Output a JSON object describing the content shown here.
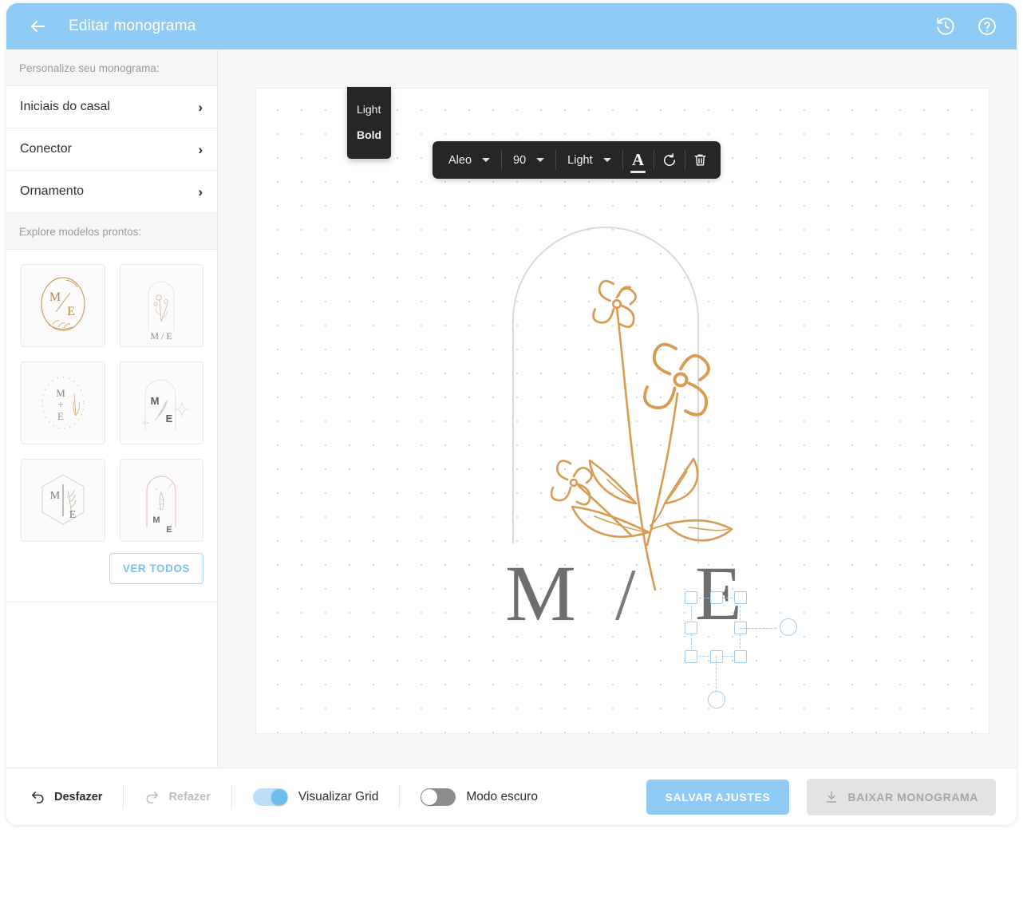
{
  "header": {
    "title": "Editar monograma",
    "back_icon": "arrow-left-icon",
    "history_icon": "history-restore-icon",
    "help_icon": "help-circle-icon",
    "accent": "#8fcbf5"
  },
  "sidebar": {
    "customize_label": "Personalize seu monograma:",
    "rows": [
      {
        "label": "Iniciais do casal",
        "chevron": "›"
      },
      {
        "label": "Conector",
        "chevron": "›"
      },
      {
        "label": "Ornamento",
        "chevron": "›"
      }
    ],
    "templates_label": "Explore modelos prontos:",
    "templates": [
      {
        "name": "template-oval-gold",
        "initial_a": "M",
        "connector": "/",
        "initial_b": "E",
        "color": "#caa05a"
      },
      {
        "name": "template-arch-floral",
        "initial_a": "M",
        "connector": "/",
        "initial_b": "E",
        "color": "#d7b5b0"
      },
      {
        "name": "template-oval-dotted",
        "initial_a": "M",
        "connector": "+",
        "initial_b": "E",
        "color": "#d8b48d"
      },
      {
        "name": "template-arch-leaf",
        "initial_a": "M",
        "connector": "",
        "initial_b": "E",
        "color": "#b9cfb4"
      },
      {
        "name": "template-hexagon",
        "initial_a": "M",
        "connector": "",
        "initial_b": "E",
        "color": "#c6bda0"
      },
      {
        "name": "template-arch-sketch",
        "initial_a": "M",
        "connector": "",
        "initial_b": "E",
        "color": "#e8b7a6"
      }
    ],
    "see_all_label": "VER TODOS"
  },
  "toolbar": {
    "font_family": "Aleo",
    "font_size": "90",
    "font_weight": "Light",
    "color_icon": "text-color-icon",
    "rotate_icon": "rotate-icon",
    "delete_icon": "trash-icon",
    "weight_options": [
      "Light",
      "Bold"
    ],
    "weight_selected": "Bold"
  },
  "canvas": {
    "monogram": {
      "initial_a": "M",
      "connector": "/",
      "initial_b": "E",
      "letter_color": "#6e6e6e"
    },
    "ornament": {
      "name": "floral-branch-ornament",
      "color": "#d89b52"
    },
    "frame": {
      "name": "arch-frame",
      "color": "#d5d5d5"
    },
    "selected_element": "initial_b",
    "grid_visible": true
  },
  "footer": {
    "undo_label": "Desfazer",
    "undo_icon": "undo-icon",
    "undo_enabled": true,
    "redo_label": "Refazer",
    "redo_icon": "redo-icon",
    "redo_enabled": false,
    "grid_toggle_label": "Visualizar Grid",
    "grid_toggle_on": true,
    "dark_toggle_label": "Modo escuro",
    "dark_toggle_on": false,
    "save_label": "SALVAR AJUSTES",
    "download_label": "BAIXAR MONOGRAMA",
    "download_icon": "download-icon",
    "download_enabled": false
  }
}
